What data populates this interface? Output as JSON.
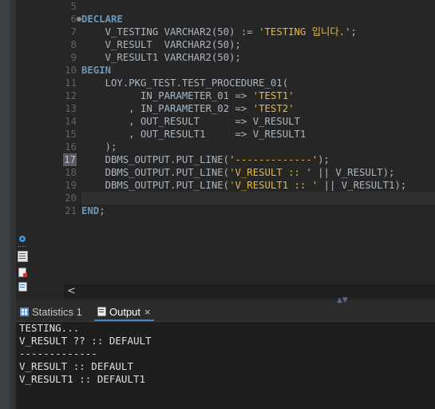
{
  "editor": {
    "lines": [
      {
        "num": "5",
        "parts": []
      },
      {
        "num": "6",
        "parts": [
          {
            "t": "kw",
            "v": "DECLARE"
          }
        ]
      },
      {
        "num": "7",
        "parts": [
          {
            "t": "p",
            "v": "    V_TESTING VARCHAR2(50) := "
          },
          {
            "t": "str",
            "v": "'TESTING 입니다.'"
          },
          {
            "t": "p",
            "v": ";"
          }
        ]
      },
      {
        "num": "8",
        "parts": [
          {
            "t": "p",
            "v": "    V_RESULT  VARCHAR2(50);"
          }
        ]
      },
      {
        "num": "9",
        "parts": [
          {
            "t": "p",
            "v": "    V_RESULT1 VARCHAR2(50);"
          }
        ]
      },
      {
        "num": "10",
        "parts": [
          {
            "t": "kw",
            "v": "BEGIN"
          }
        ]
      },
      {
        "num": "11",
        "parts": [
          {
            "t": "p",
            "v": "    LOY.PKG_TEST.TEST_PROCEDURE_01("
          }
        ]
      },
      {
        "num": "12",
        "parts": [
          {
            "t": "p",
            "v": "          IN_PARAMETER_01 => "
          },
          {
            "t": "str",
            "v": "'TEST1'"
          }
        ]
      },
      {
        "num": "13",
        "parts": [
          {
            "t": "p",
            "v": "        , IN_PARAMETER_02 => "
          },
          {
            "t": "str",
            "v": "'TEST2'"
          }
        ]
      },
      {
        "num": "14",
        "parts": [
          {
            "t": "p",
            "v": "        , OUT_RESULT      => V_RESULT"
          }
        ]
      },
      {
        "num": "15",
        "parts": [
          {
            "t": "p",
            "v": "        , OUT_RESULT1     => V_RESULT1"
          }
        ]
      },
      {
        "num": "16",
        "parts": [
          {
            "t": "p",
            "v": "    );"
          }
        ]
      },
      {
        "num": "17",
        "parts": [
          {
            "t": "p",
            "v": "    DBMS_OUTPUT.PUT_LINE("
          },
          {
            "t": "str",
            "v": "'-------------'"
          },
          {
            "t": "p",
            "v": ");"
          }
        ]
      },
      {
        "num": "18",
        "parts": [
          {
            "t": "p",
            "v": "    DBMS_OUTPUT.PUT_LINE("
          },
          {
            "t": "str",
            "v": "'V_RESULT :: '"
          },
          {
            "t": "p",
            "v": " || V_RESULT);"
          }
        ]
      },
      {
        "num": "19",
        "parts": [
          {
            "t": "p",
            "v": "    DBMS_OUTPUT.PUT_LINE("
          },
          {
            "t": "str",
            "v": "'V_RESULT1 :: '"
          },
          {
            "t": "p",
            "v": " || V_RESULT1);"
          }
        ]
      },
      {
        "num": "20",
        "parts": []
      },
      {
        "num": "21",
        "parts": [
          {
            "t": "kw",
            "v": "END"
          },
          {
            "t": "p",
            "v": ";"
          }
        ]
      }
    ],
    "current_line": "17",
    "highlight_line": "20"
  },
  "scroll": {
    "left_arrow": "<"
  },
  "tabs": [
    {
      "label": "Statistics 1",
      "icon": "statistics-icon"
    },
    {
      "label": "Output",
      "icon": "output-icon",
      "close": "×"
    }
  ],
  "output": {
    "lines": [
      "TESTING...",
      "V_RESULT ?? :: DEFAULT",
      "-------------",
      "V_RESULT :: DEFAULT",
      "V_RESULT1 :: DEFAULT1"
    ]
  },
  "colors": {
    "keyword": "#6897bb",
    "string": "#e8b93c",
    "text": "#a9b7c6",
    "accent": "#4a88c7"
  }
}
